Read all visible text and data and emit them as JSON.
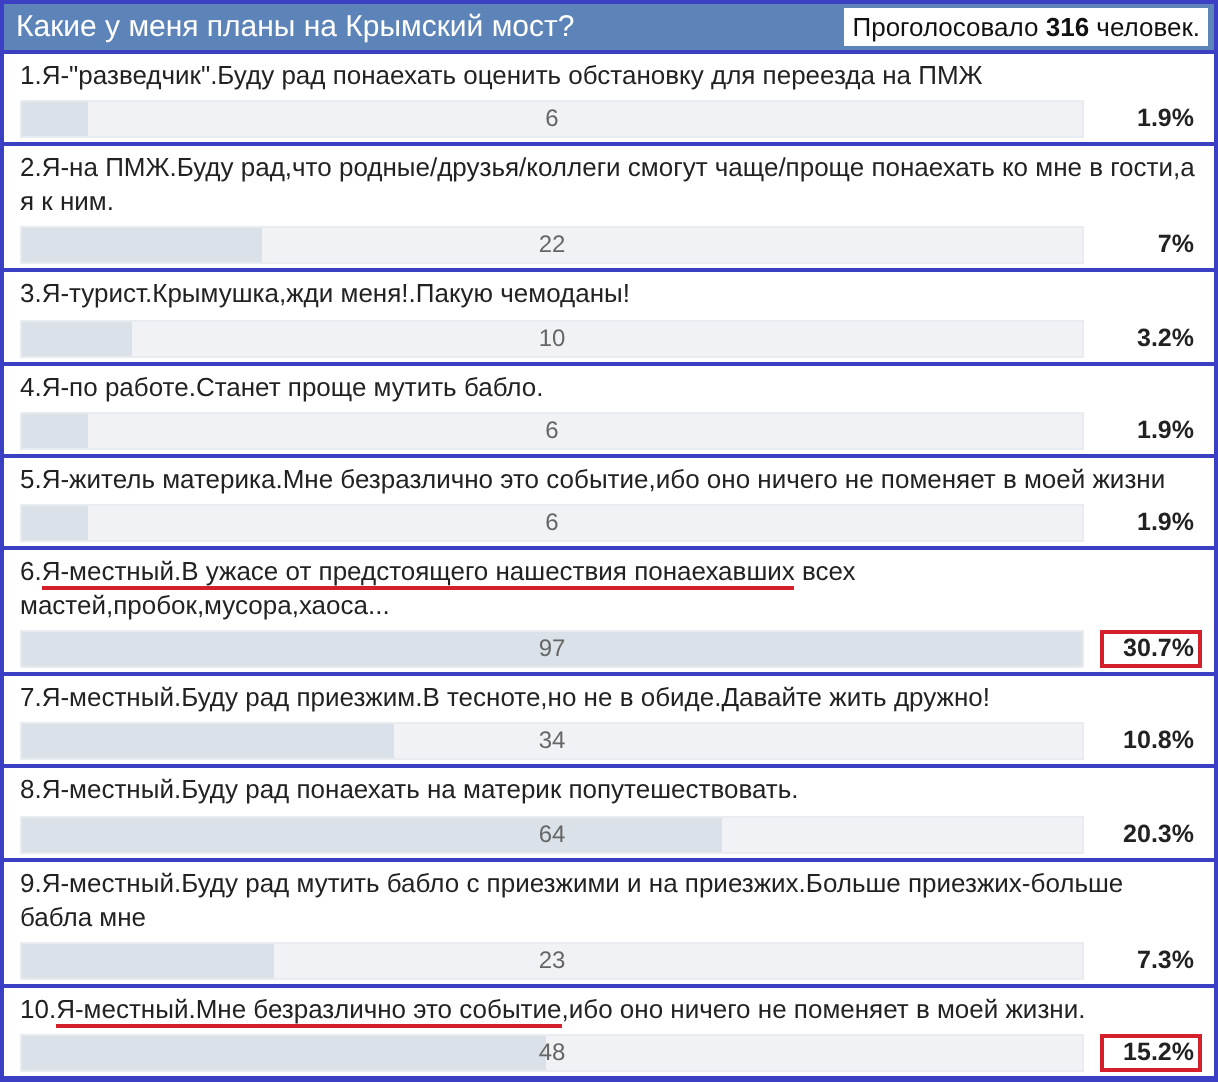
{
  "poll": {
    "title": "Какие у меня планы на Крымский мост?",
    "total_votes": "Проголосовало **316** человек.",
    "options": [
      {
        "text_parts": [
          {
            "text": "1.Я-\"разведчик\".Буду рад понаехать оценить обстановку для переезда на ПМЖ",
            "underlined": false
          }
        ],
        "count": "6",
        "percent": "1.9%",
        "level": 0.062,
        "highlighted": false
      },
      {
        "text_parts": [
          {
            "text": "2.Я-на ПМЖ.Буду рад,что родные/друзья/коллеги смогут чаще/проще понаехать ко мне в гости,а я к ним.",
            "underlined": false
          }
        ],
        "count": "22",
        "percent": "7%",
        "level": 0.227,
        "highlighted": false
      },
      {
        "text_parts": [
          {
            "text": "3.Я-турист.Крымушка,жди меня!.Пакую чемоданы!",
            "underlined": false
          }
        ],
        "count": "10",
        "percent": "3.2%",
        "level": 0.103,
        "highlighted": false
      },
      {
        "text_parts": [
          {
            "text": "4.Я-по работе.Станет проще мутить бабло.",
            "underlined": false
          }
        ],
        "count": "6",
        "percent": "1.9%",
        "level": 0.062,
        "highlighted": false
      },
      {
        "text_parts": [
          {
            "text": "5.Я-житель материка.Мне безразлично это событие,ибо оно ничего не поменяет в моей жизни",
            "underlined": false
          }
        ],
        "count": "6",
        "percent": "1.9%",
        "level": 0.062,
        "highlighted": false
      },
      {
        "text_parts": [
          {
            "text": "6.",
            "underlined": false
          },
          {
            "text": "Я-местный.В ужасе от предстоящего нашествия понаехавших",
            "underlined": true
          },
          {
            "text": " всех мастей,пробок,мусора,хаоса...",
            "underlined": false
          }
        ],
        "count": "97",
        "percent": "30.7%",
        "level": 1,
        "highlighted": true
      },
      {
        "text_parts": [
          {
            "text": "7.Я-местный.Буду рад приезжим.В тесноте,но не в обиде.Давайте жить дружно!",
            "underlined": false
          }
        ],
        "count": "34",
        "percent": "10.8%",
        "level": 0.351,
        "highlighted": false
      },
      {
        "text_parts": [
          {
            "text": "8.Я-местный.Буду рад понаехать на материк попутешествовать.",
            "underlined": false
          }
        ],
        "count": "64",
        "percent": "20.3%",
        "level": 0.66,
        "highlighted": false
      },
      {
        "text_parts": [
          {
            "text": "9.Я-местный.Буду рад мутить бабло с приезжими и на приезжих.Больше приезжих-больше бабла мне",
            "underlined": false
          }
        ],
        "count": "23",
        "percent": "7.3%",
        "level": 0.237,
        "highlighted": false
      },
      {
        "text_parts": [
          {
            "text": "10.",
            "underlined": false
          },
          {
            "text": "Я-местный.Мне безразлично это событие",
            "underlined": true
          },
          {
            "text": ",ибо оно ничего не поменяет в моей жизни.",
            "underlined": false
          }
        ],
        "count": "48",
        "percent": "15.2%",
        "level": 0.495,
        "highlighted": true
      }
    ]
  }
}
